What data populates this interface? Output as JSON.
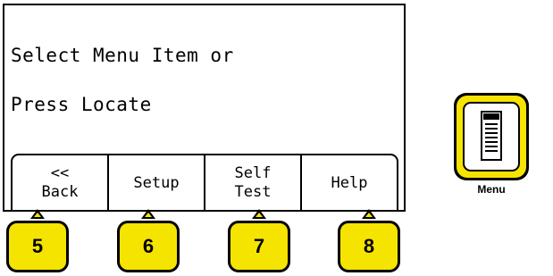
{
  "display": {
    "line1": "Select Menu Item or",
    "line2": "Press Locate"
  },
  "softkeys": [
    {
      "line1": "<<",
      "line2": "Back"
    },
    {
      "line1": "Setup",
      "line2": ""
    },
    {
      "line1": "Self",
      "line2": "Test"
    },
    {
      "line1": "Help",
      "line2": ""
    }
  ],
  "hardkeys": [
    "5",
    "6",
    "7",
    "8"
  ],
  "menu_button": {
    "label": "Menu",
    "icon": "menu-list-icon"
  },
  "colors": {
    "key_yellow": "#f5e400",
    "outline": "#000000",
    "screen": "#ffffff"
  }
}
